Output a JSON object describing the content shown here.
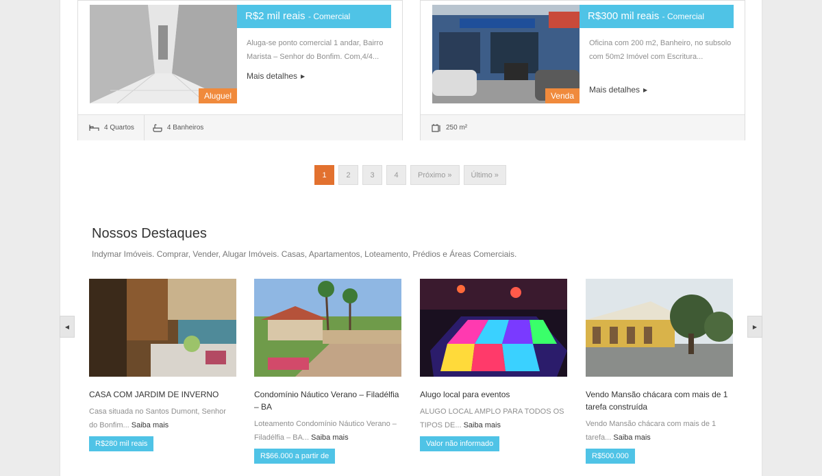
{
  "listings": [
    {
      "price": "R$2 mil reais",
      "category": "- Comercial",
      "tag": "Aluguel",
      "description": "Aluga-se ponto comercial 1 andar, Bairro Marista – Senhor do Bonfim. Com,4/4...",
      "more_label": "Mais detalhes",
      "features": [
        {
          "icon": "bed-icon",
          "label": "4 Quartos"
        },
        {
          "icon": "bathtub-icon",
          "label": "4 Banheiros"
        }
      ]
    },
    {
      "price": "R$300 mil reais",
      "category": "- Comercial",
      "tag": "Venda",
      "description": "Oficina com 200 m2, Banheiro, no subsolo com 50m2 Imóvel com Escritura...",
      "more_label": "Mais detalhes",
      "features": [
        {
          "icon": "area-icon",
          "label": "250 m²"
        }
      ]
    }
  ],
  "pagination": {
    "pages": [
      "1",
      "2",
      "3",
      "4"
    ],
    "current": "1",
    "next_label": "Próximo »",
    "last_label": "Último »"
  },
  "featured": {
    "title": "Nossos Destaques",
    "subtitle": "Indymar Imóveis. Comprar, Vender, Alugar Imóveis. Casas, Apartamentos, Loteamento, Prédios e Áreas Comerciais.",
    "prev_icon": "caret-left-icon",
    "next_icon": "caret-right-icon",
    "items": [
      {
        "title": "CASA COM JARDIM DE INVERNO",
        "description": "Casa situada no Santos Dumont, Senhor do Bonfim...",
        "more": "Saiba mais",
        "price": "R$280 mil reais"
      },
      {
        "title": "Condomínio Náutico Verano – Filadélfia – BA",
        "description": "Loteamento Condomínio Náutico Verano – Filadélfia – BA...",
        "more": "Saiba mais",
        "price": "R$66.000 a partir de"
      },
      {
        "title": "Alugo local para eventos",
        "description": "ALUGO LOCAL AMPLO PARA TODOS OS TIPOS DE...",
        "more": "Saiba mais",
        "price": "Valor não informado"
      },
      {
        "title": "Vendo Mansão chácara com mais de 1 tarefa construída",
        "description": "Vendo Mansão chácara com mais de 1 tarefa...",
        "more": "Saiba mais",
        "price": "R$500.000"
      }
    ]
  },
  "colors": {
    "accent_blue": "#4fc3e6",
    "accent_orange": "#f08a3c",
    "active_page": "#e2712f"
  }
}
